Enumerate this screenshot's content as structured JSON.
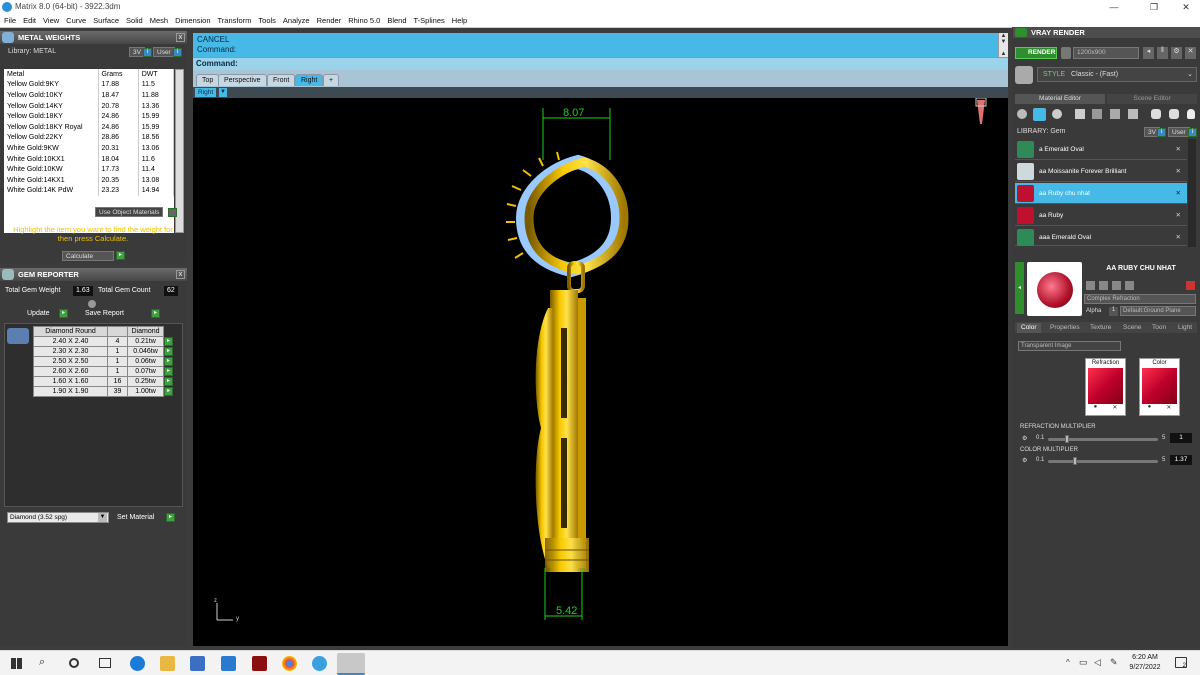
{
  "titlebar": {
    "title": "Matrix 8.0 (64-bit) - 3922.3dm"
  },
  "menu": [
    "File",
    "Edit",
    "View",
    "Curve",
    "Surface",
    "Solid",
    "Mesh",
    "Dimension",
    "Transform",
    "Tools",
    "Analyze",
    "Render",
    "Rhino 5.0",
    "Blend",
    "T-Splines",
    "Help"
  ],
  "metal_weights": {
    "title": "METAL WEIGHTS",
    "library_label": "Library: METAL",
    "lib_btn1": "3V",
    "lib_btn2": "User",
    "columns": [
      "Metal",
      "Grams",
      "DWT"
    ],
    "rows": [
      [
        "Yellow Gold:9KY",
        "17.88",
        "11.5"
      ],
      [
        "Yellow Gold:10KY",
        "18.47",
        "11.88"
      ],
      [
        "Yellow Gold:14KY",
        "20.78",
        "13.36"
      ],
      [
        "Yellow Gold:18KY",
        "24.86",
        "15.99"
      ],
      [
        "Yellow Gold:18KY Royal",
        "24.86",
        "15.99"
      ],
      [
        "Yellow Gold:22KY",
        "28.86",
        "18.56"
      ],
      [
        "White Gold:9KW",
        "20.31",
        "13.06"
      ],
      [
        "White Gold:10KX1",
        "18.04",
        "11.6"
      ],
      [
        "White Gold:10KW",
        "17.73",
        "11.4"
      ],
      [
        "White Gold:14KX1",
        "20.35",
        "13.08"
      ],
      [
        "White Gold:14K PdW",
        "23.23",
        "14.94"
      ]
    ],
    "use_object_materials": "Use Object Materials",
    "hint": "Highlight the item you want to find the weight for then press Calculate.",
    "calculate_label": "Calculate"
  },
  "gem_reporter": {
    "title": "GEM REPORTER",
    "total_weight_label": "Total Gem Weight",
    "total_weight": "1.63",
    "total_count_label": "Total Gem Count",
    "total_count": "62",
    "update_label": "Update",
    "save_label": "Save Report",
    "columns": [
      "Diamond Round",
      "",
      "Diamond"
    ],
    "rows": [
      [
        "2.40 X 2.40",
        "4",
        "0.21tw"
      ],
      [
        "2.30 X 2.30",
        "1",
        "0.046tw"
      ],
      [
        "2.50 X 2.50",
        "1",
        "0.06tw"
      ],
      [
        "2.60 X 2.60",
        "1",
        "0.07tw"
      ],
      [
        "1.60 X 1.60",
        "16",
        "0.25tw"
      ],
      [
        "1.90 X 1.90",
        "39",
        "1.00tw"
      ]
    ],
    "material_select": "Diamond    (3.52 spg)",
    "set_material": "Set Material"
  },
  "command": {
    "line1": "CANCEL",
    "line2": "Command:",
    "prompt": "Command:"
  },
  "viewport_tabs": [
    "Top",
    "Perspective",
    "Front",
    "Right",
    "+"
  ],
  "active_view": "Right",
  "viewport_label": "Right",
  "dimensions": {
    "top": "8.07",
    "bottom": "5.42"
  },
  "axis": {
    "z": "z",
    "y": "y"
  },
  "vray": {
    "title": "VRAY RENDER",
    "render_label": "RENDER",
    "resolution": "1200x900",
    "mode": "Classic - (Fast)",
    "mode_prefix": "STYLE",
    "tab_material": "Material Editor",
    "tab_scene": "Scene Editor",
    "library_label": "LIBRARY: Gem",
    "lib_btn1": "3V",
    "lib_btn2": "User",
    "materials": [
      {
        "name": "a Emerald Oval",
        "color": "#2e8b57"
      },
      {
        "name": "aa Moissanite Forever Brilliant",
        "color": "#cfd8dc"
      },
      {
        "name": "aa Ruby chu nhat",
        "color": "#c01030"
      },
      {
        "name": "aa Ruby",
        "color": "#c01030"
      },
      {
        "name": "aaa Emerald Oval",
        "color": "#2e8b57"
      }
    ],
    "selected_material": "AA RUBY CHU NHAT",
    "shader_type": "Complex Refraction",
    "alpha_label": "Alpha",
    "alpha_value": "1",
    "ground_plane": "Default:Ground Plane",
    "subtabs": [
      "Color",
      "Properties",
      "Texture",
      "Scene",
      "Toon",
      "Light"
    ],
    "transparent_image": "Transparent Image",
    "refraction_label": "Refraction",
    "color_label": "Color",
    "refraction_mult_label": "REFRACTION MULTIPLIER",
    "refraction_min": "0.1",
    "refraction_max": "5",
    "refraction_value": "1",
    "color_mult_label": "COLOR MULTIPLIER",
    "color_min": "0.1",
    "color_max": "5",
    "color_value": "1.37"
  },
  "taskbar": {
    "time": "6:20 AM",
    "date": "9/27/2022",
    "notif": "2"
  }
}
